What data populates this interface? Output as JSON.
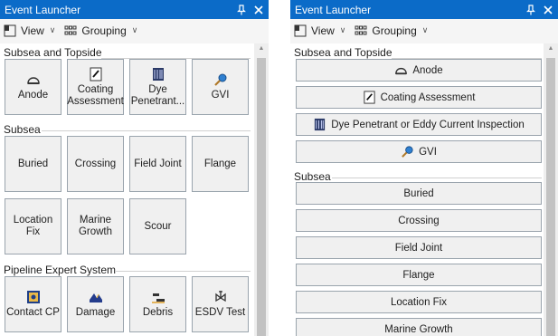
{
  "left": {
    "title": "Event Launcher",
    "toolbar": {
      "view": "View",
      "grouping": "Grouping"
    },
    "groups": [
      {
        "label": "Subsea and Topside",
        "items": [
          "Anode",
          "Coating Assessment",
          "Dye Penetrant...",
          "GVI"
        ]
      },
      {
        "label": "Subsea",
        "items": [
          "Buried",
          "Crossing",
          "Field Joint",
          "Flange",
          "Location Fix",
          "Marine Growth",
          "Scour"
        ]
      },
      {
        "label": "Pipeline Expert System",
        "items": [
          "Contact CP",
          "Damage",
          "Debris",
          "ESDV Test"
        ]
      }
    ]
  },
  "right": {
    "title": "Event Launcher",
    "toolbar": {
      "view": "View",
      "grouping": "Grouping"
    },
    "groups": [
      {
        "label": "Subsea and Topside",
        "items": [
          "Anode",
          "Coating Assessment",
          "Dye Penetrant or Eddy Current Inspection",
          "GVI"
        ]
      },
      {
        "label": "Subsea",
        "items": [
          "Buried",
          "Crossing",
          "Field Joint",
          "Flange",
          "Location Fix",
          "Marine Growth"
        ]
      }
    ]
  },
  "icons": {
    "pin": "pin-icon",
    "close": "close-icon",
    "view": "view-icon",
    "grouping": "grouping-icon",
    "anode": "anode-icon",
    "coating": "coating-icon",
    "dye": "dye-penetrant-icon",
    "gvi": "magnifier-icon",
    "contact_cp": "contact-cp-icon",
    "damage": "damage-icon",
    "debris": "debris-icon",
    "esdv": "esdv-test-icon"
  },
  "colors": {
    "titlebar": "#0b6bc8",
    "tile_bg": "#f0f0f0",
    "tile_border": "#9aa4ad"
  }
}
